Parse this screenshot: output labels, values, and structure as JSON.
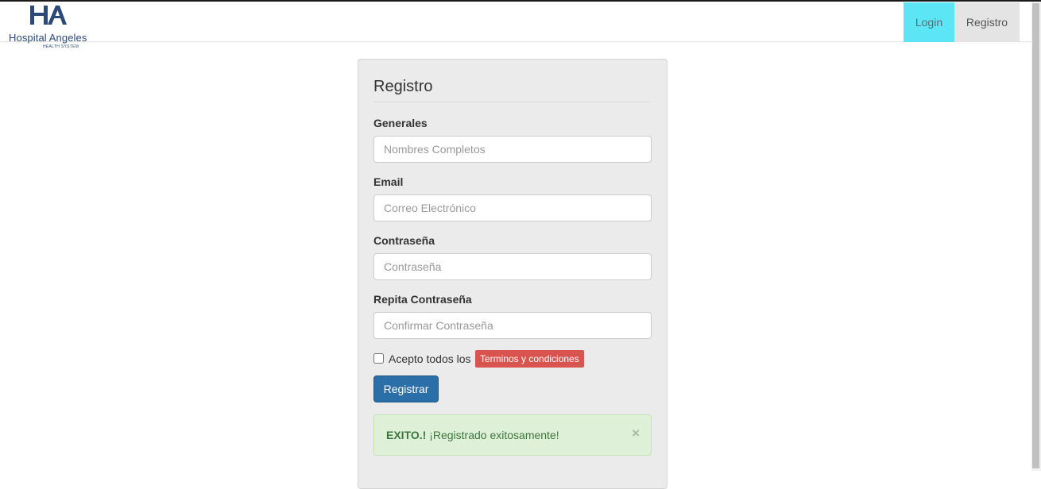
{
  "brand": {
    "name": "Hospital Angeles",
    "subtitle": "HEALTH SYSTEM",
    "logo_icon": "ha-logo-icon",
    "color": "#2c4a78"
  },
  "nav": {
    "login": "Login",
    "registro": "Registro",
    "active_color": "#5ce6f5"
  },
  "form": {
    "title": "Registro",
    "fields": [
      {
        "label": "Generales",
        "placeholder": "Nombres Completos",
        "value": ""
      },
      {
        "label": "Email",
        "placeholder": "Correo Electrónico",
        "value": ""
      },
      {
        "label": "Contraseña",
        "placeholder": "Contraseña",
        "value": ""
      },
      {
        "label": "Repita Contraseña",
        "placeholder": "Confirmar Contraseña",
        "value": ""
      }
    ],
    "terms_text": "Acepto todos los",
    "terms_link": "Terminos y condiciones",
    "terms_checked": false,
    "submit": "Registrar"
  },
  "alert": {
    "strong": "EXITO.!",
    "message": "¡Registrado exitosamente!",
    "close": "×",
    "color": "#3c763d"
  }
}
